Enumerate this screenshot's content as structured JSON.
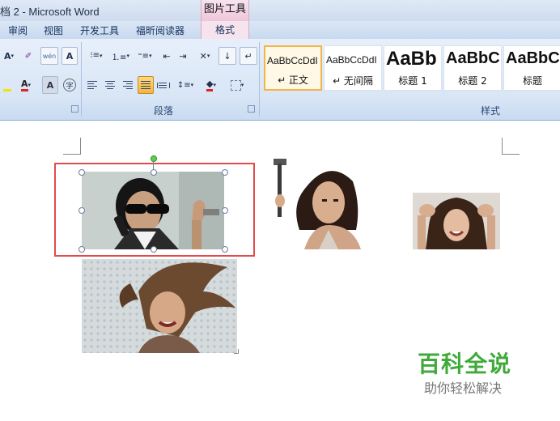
{
  "window": {
    "title": "档 2 - Microsoft Word",
    "context_tool": "图片工具"
  },
  "tabs": [
    "审阅",
    "视图",
    "开发工具",
    "福昕阅读器",
    "格式"
  ],
  "ribbon": {
    "groups": {
      "paragraph": "段落",
      "styles": "样式"
    },
    "styles": [
      {
        "preview": "AaBbCcDdI",
        "name": "↵ 正文"
      },
      {
        "preview": "AaBbCcDdI",
        "name": "↵ 无间隔"
      },
      {
        "preview": "AaBb",
        "name": "标题 1"
      },
      {
        "preview": "AaBbC",
        "name": "标题 2"
      },
      {
        "preview": "AaBbC",
        "name": "标题"
      }
    ],
    "font_buttons": {
      "font_size_down": "A",
      "format_painter": "ab",
      "wen": "wén",
      "char_border": "A",
      "char_shading": "A",
      "enclose": "字"
    }
  },
  "document": {
    "images": [
      {
        "desc": "woman-phone-sunglasses",
        "selected": true
      },
      {
        "desc": "woman-hammer"
      },
      {
        "desc": "woman-hands-head"
      },
      {
        "desc": "woman-wind-hair"
      }
    ]
  },
  "watermark": {
    "title": "百科全说",
    "subtitle": "助你轻松解决"
  },
  "colors": {
    "accent_green": "#3faa3a",
    "selection_red": "#e34b4b",
    "ribbon_blue": "#d9e6f6"
  }
}
